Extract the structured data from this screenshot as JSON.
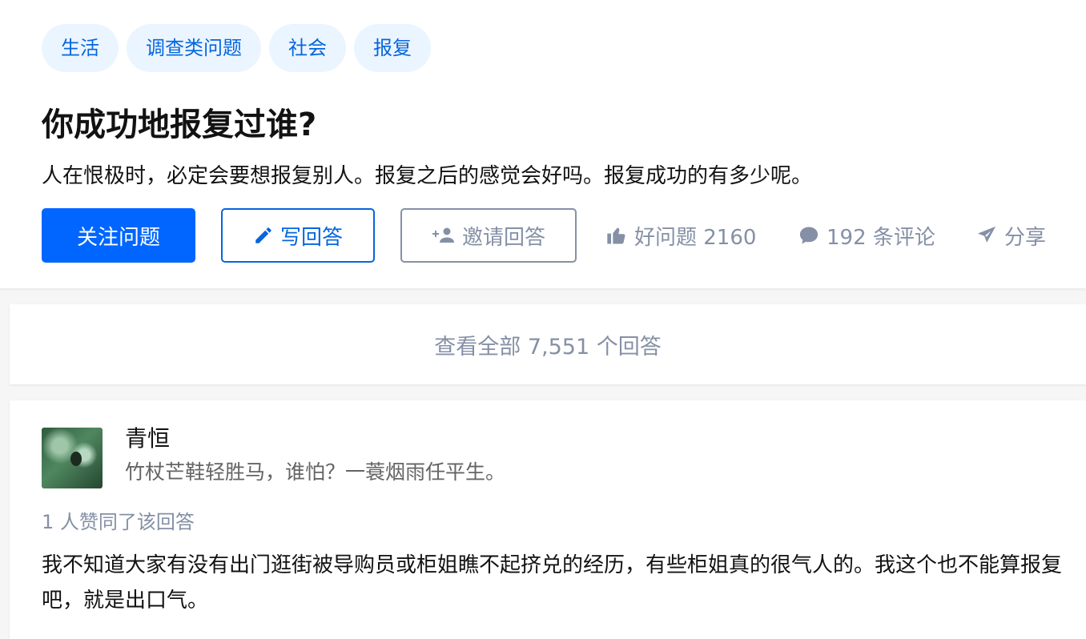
{
  "question": {
    "topics": [
      "生活",
      "调查类问题",
      "社会",
      "报复"
    ],
    "title": "你成功地报复过谁?",
    "detail": "人在恨极时，必定会要想报复别人。报复之后的感觉会好吗。报复成功的有多少呢。",
    "actions": {
      "follow_label": "关注问题",
      "write_label": "写回答",
      "invite_label": "邀请回答",
      "upvote_label": "好问题 2160",
      "comments_label": "192 条评论",
      "share_label": "分享"
    },
    "view_all_label": "查看全部 7,551 个回答"
  },
  "answer": {
    "author_name": "青恒",
    "author_bio": "竹杖芒鞋轻胜马，谁怕？一蓑烟雨任平生。",
    "vote_info": "1 人赞同了该回答",
    "content": "我不知道大家有没有出门逛街被导购员或柜姐瞧不起挤兑的经历，有些柜姐真的很气人的。我这个也不能算报复吧，就是出口气。"
  },
  "icons": {
    "write": "pencil-icon",
    "invite": "add-user-icon",
    "upvote": "thumbs-up-icon",
    "comments": "comment-bubble-icon",
    "share": "paper-plane-icon"
  },
  "colors": {
    "primary": "#0066ff",
    "topic_bg": "#ebf5ff",
    "topic_text": "#0566dd",
    "muted": "#8590a6",
    "text": "#121212"
  }
}
